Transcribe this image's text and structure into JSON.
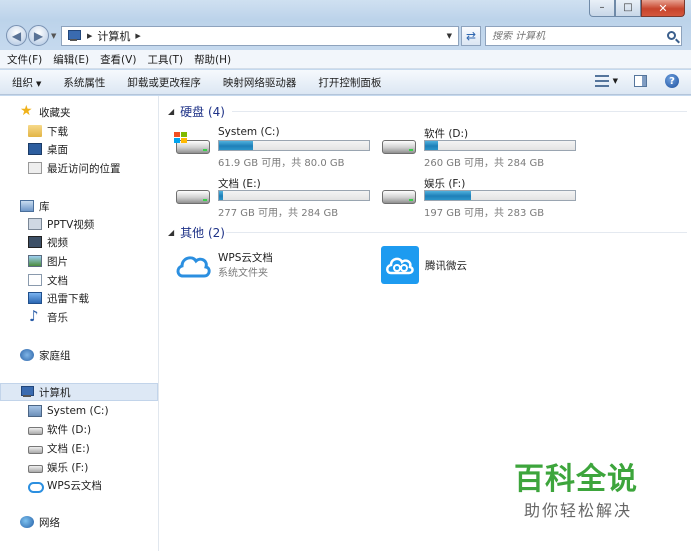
{
  "window": {
    "caption": {
      "minimize": "–",
      "maximize": "□",
      "close": "✕"
    }
  },
  "address": {
    "location": "计算机",
    "search_placeholder": "搜索 计算机"
  },
  "menubar": {
    "items": [
      "文件(F)",
      "编辑(E)",
      "查看(V)",
      "工具(T)",
      "帮助(H)"
    ]
  },
  "toolbar": {
    "organize": "组织",
    "items": [
      "系统属性",
      "卸载或更改程序",
      "映射网络驱动器",
      "打开控制面板"
    ],
    "help": "?"
  },
  "sidebar": {
    "favorites": {
      "label": "收藏夹",
      "icon": "star-icon"
    },
    "favorites_items": [
      {
        "label": "下载",
        "icon": "download-folder-icon"
      },
      {
        "label": "桌面",
        "icon": "desktop-icon"
      },
      {
        "label": "最近访问的位置",
        "icon": "recent-places-icon"
      }
    ],
    "libraries": {
      "label": "库",
      "icon": "library-icon"
    },
    "library_items": [
      {
        "label": "PPTV视频",
        "icon": "pptv-icon"
      },
      {
        "label": "视频",
        "icon": "video-icon"
      },
      {
        "label": "图片",
        "icon": "pictures-icon"
      },
      {
        "label": "文档",
        "icon": "documents-icon"
      },
      {
        "label": "迅雷下载",
        "icon": "thunder-icon"
      },
      {
        "label": "音乐",
        "icon": "music-icon"
      }
    ],
    "homegroup": {
      "label": "家庭组",
      "icon": "homegroup-icon"
    },
    "computer": {
      "label": "计算机",
      "icon": "computer-icon"
    },
    "computer_items": [
      {
        "label": "System (C:)",
        "icon": "system-drive-icon"
      },
      {
        "label": "软件 (D:)",
        "icon": "drive-icon"
      },
      {
        "label": "文档 (E:)",
        "icon": "drive-icon"
      },
      {
        "label": "娱乐 (F:)",
        "icon": "drive-icon"
      },
      {
        "label": "WPS云文档",
        "icon": "wps-cloud-icon"
      }
    ],
    "network": {
      "label": "网络",
      "icon": "network-icon"
    }
  },
  "main": {
    "hard_disks": {
      "heading": "硬盘 (4)",
      "drives": [
        {
          "name": "System (C:)",
          "free": "61.9 GB 可用，共 80.0 GB",
          "used_fraction": 0.226,
          "icon": "system-drive-icon"
        },
        {
          "name": "软件 (D:)",
          "free": "260 GB 可用，共 284 GB",
          "used_fraction": 0.085,
          "icon": "drive-icon"
        },
        {
          "name": "文档 (E:)",
          "free": "277 GB 可用，共 284 GB",
          "used_fraction": 0.025,
          "icon": "drive-icon"
        },
        {
          "name": "娱乐 (F:)",
          "free": "197 GB 可用，共 283 GB",
          "used_fraction": 0.304,
          "icon": "drive-icon"
        }
      ]
    },
    "other": {
      "heading": "其他 (2)",
      "items": [
        {
          "name": "WPS云文档",
          "subtitle": "系统文件夹",
          "icon": "wps-cloud-icon"
        },
        {
          "name": "腾讯微云",
          "subtitle": "",
          "icon": "tencent-weiyun-icon"
        }
      ]
    }
  },
  "watermark": {
    "title": "百科全说",
    "subtitle": "助你轻松解决"
  },
  "colors": {
    "drive_fill": "#2c8fc6",
    "group_heading": "#1e3287",
    "watermark_green": "#3da53c",
    "selected_bg": "#dde8f5"
  }
}
